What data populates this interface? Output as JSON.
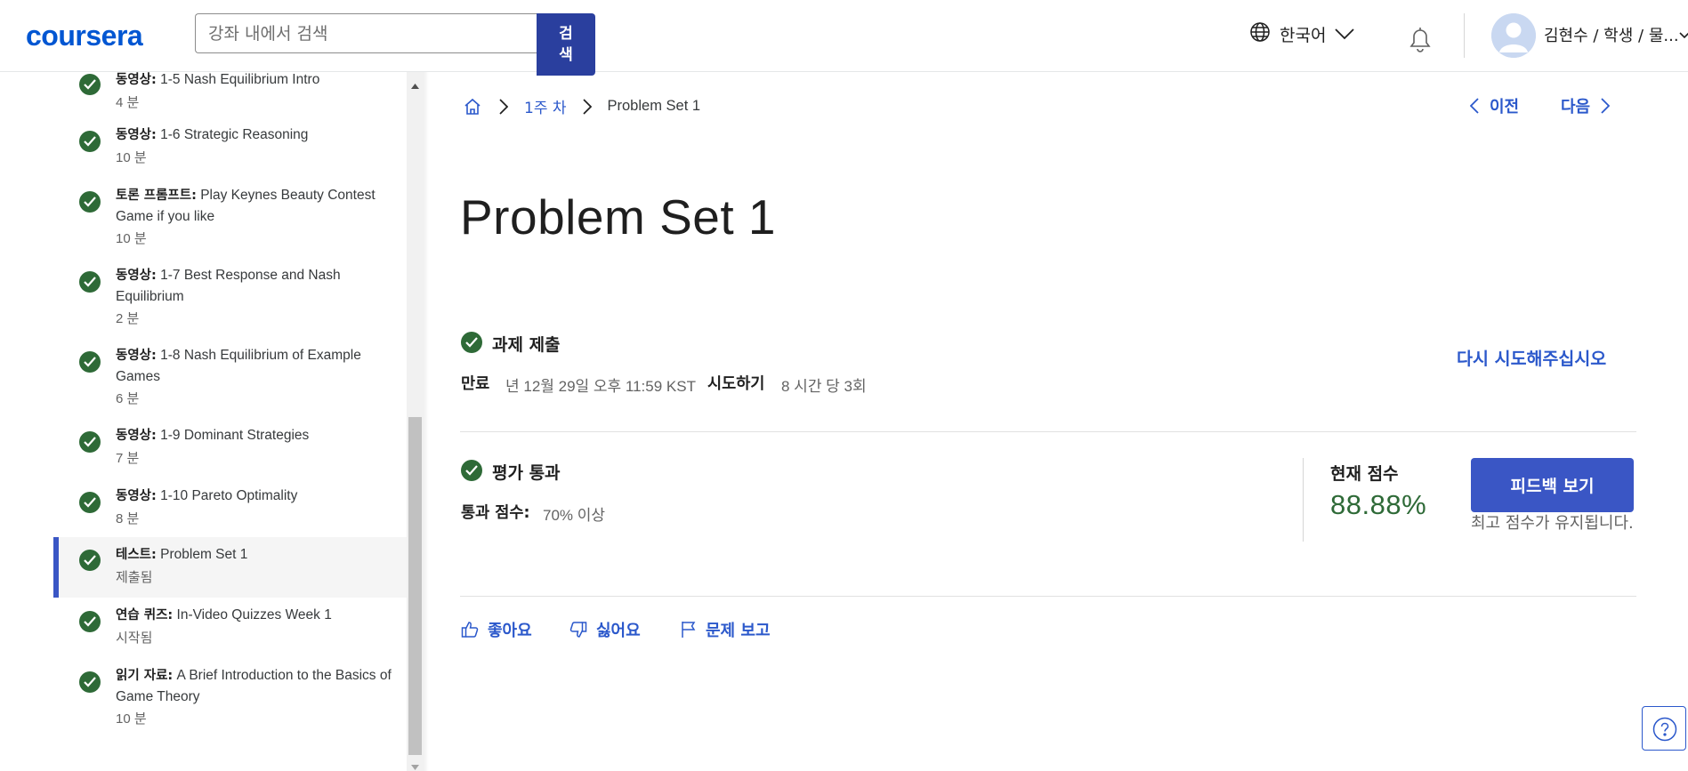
{
  "header": {
    "logo": "coursera",
    "search_placeholder": "강좌 내에서 검색",
    "search_button": "검\n색",
    "language": "한국어",
    "user_label": "김현수 / 학생 / 물..."
  },
  "sidebar": {
    "items": [
      {
        "type": "동영상:",
        "title": " 1-5 Nash Equilibrium Intro",
        "meta": "4 분",
        "active": false
      },
      {
        "type": "동영상:",
        "title": " 1-6 Strategic Reasoning",
        "meta": "10 분",
        "active": false
      },
      {
        "type": "토론 프롬프트:",
        "title": " Play Keynes Beauty Contest Game if you like",
        "meta": "10 분",
        "active": false
      },
      {
        "type": "동영상:",
        "title": " 1-7 Best Response and Nash Equilibrium",
        "meta": "2 분",
        "active": false
      },
      {
        "type": "동영상:",
        "title": " 1-8 Nash Equilibrium of Example Games",
        "meta": "6 분",
        "active": false
      },
      {
        "type": "동영상:",
        "title": " 1-9 Dominant Strategies",
        "meta": "7 분",
        "active": false
      },
      {
        "type": "동영상:",
        "title": " 1-10 Pareto Optimality",
        "meta": "8 분",
        "active": false
      },
      {
        "type": "테스트:",
        "title": " Problem Set 1",
        "meta": "제출됨",
        "active": true
      },
      {
        "type": "연습 퀴즈:",
        "title": " In-Video Quizzes Week 1",
        "meta": "시작됨",
        "active": false
      },
      {
        "type": "읽기 자료:",
        "title": " A Brief Introduction to the Basics of Game Theory",
        "meta": "10 분",
        "active": false
      }
    ]
  },
  "breadcrumb": {
    "week": "1주 차",
    "current": "Problem Set 1"
  },
  "nav": {
    "prev": "이전",
    "next": "다음"
  },
  "page_title": "Problem Set 1",
  "submission": {
    "heading": "과제 제출",
    "due_label": "만료",
    "due_value": "년 12월 29일 오후 11:59 KST",
    "attempts_label": "시도하기",
    "attempts_value": "8 시간 당 3회",
    "retry": "다시 시도해주십시오"
  },
  "grade": {
    "heading": "평가 통과",
    "passing_label": "통과 점수:",
    "passing_value": "70% 이상",
    "current_label": "현재 점수",
    "current_value": "88.88%",
    "feedback_button": "피드백 보기",
    "keep_note": "최고 점수가 유지됩니다."
  },
  "actions": {
    "like": "좋아요",
    "dislike": "싫어요",
    "report": "문제 보고"
  },
  "colors": {
    "brand": "#0056d2",
    "primary": "#3a56c5",
    "link": "#2b58cb",
    "success": "#2e6a37"
  },
  "icons": [
    "search-icon",
    "globe-icon",
    "chevron-down-icon",
    "bell-icon",
    "avatar",
    "home-icon",
    "chevron-right-icon",
    "chevron-left-icon",
    "check-circle-icon",
    "thumbs-up-icon",
    "thumbs-down-icon",
    "flag-icon",
    "help-icon"
  ]
}
